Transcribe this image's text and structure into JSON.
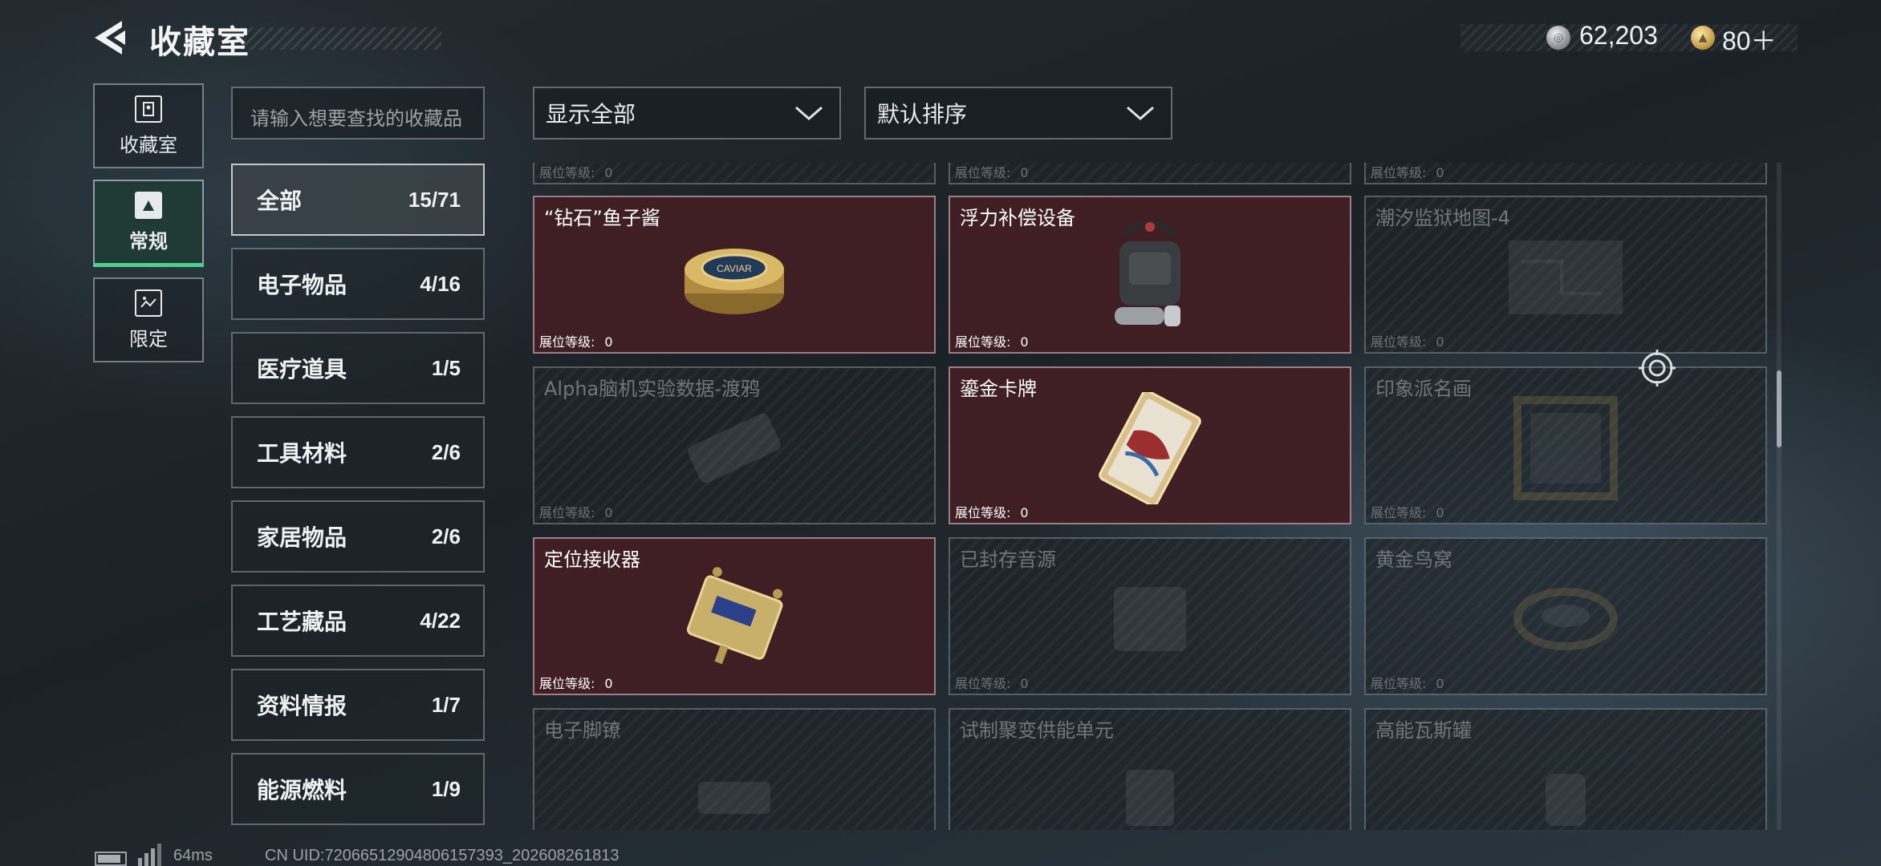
{
  "header": {
    "title": "收藏室",
    "currency_silver": "62,203",
    "currency_gold": "80＋"
  },
  "nav": {
    "tabs": [
      {
        "label": "收藏室",
        "icon": "collection-room-icon"
      },
      {
        "label": "常规",
        "icon": "regular-collection-icon",
        "active": true
      },
      {
        "label": "限定",
        "icon": "limited-collection-icon"
      }
    ]
  },
  "search": {
    "placeholder": "请输入想要查找的收藏品"
  },
  "categories": [
    {
      "label": "全部",
      "count": "15/71",
      "active": true
    },
    {
      "label": "电子物品",
      "count": "4/16"
    },
    {
      "label": "医疗道具",
      "count": "1/5"
    },
    {
      "label": "工具材料",
      "count": "2/6"
    },
    {
      "label": "家居物品",
      "count": "2/6"
    },
    {
      "label": "工艺藏品",
      "count": "4/22"
    },
    {
      "label": "资料情报",
      "count": "1/7"
    },
    {
      "label": "能源燃料",
      "count": "1/9"
    }
  ],
  "filters": {
    "display": "显示全部",
    "sort": "默认排序"
  },
  "level_label": "展位等级:",
  "items": [
    {
      "name": "",
      "level": "0",
      "owned": false
    },
    {
      "name": "",
      "level": "0",
      "owned": false
    },
    {
      "name": "",
      "level": "0",
      "owned": false
    },
    {
      "name": "“钻石”鱼子酱",
      "level": "0",
      "owned": true,
      "icon": "caviar-tin-icon"
    },
    {
      "name": "浮力补偿设备",
      "level": "0",
      "owned": true,
      "icon": "buoyancy-device-icon"
    },
    {
      "name": "潮汐监狱地图-4",
      "level": "0",
      "owned": false,
      "icon": "map-icon"
    },
    {
      "name": "Alpha脑机实验数据-渡鸦",
      "level": "0",
      "owned": false,
      "icon": "data-module-icon"
    },
    {
      "name": "鎏金卡牌",
      "level": "0",
      "owned": true,
      "icon": "gilded-card-icon"
    },
    {
      "name": "印象派名画",
      "level": "0",
      "owned": false,
      "icon": "painting-icon"
    },
    {
      "name": "定位接收器",
      "level": "0",
      "owned": true,
      "icon": "locator-receiver-icon"
    },
    {
      "name": "已封存音源",
      "level": "0",
      "owned": false,
      "icon": "sealed-audio-icon"
    },
    {
      "name": "黄金鸟窝",
      "level": "0",
      "owned": false,
      "icon": "golden-nest-icon"
    },
    {
      "name": "电子脚镣",
      "level": "",
      "owned": false,
      "icon": "ankle-monitor-icon"
    },
    {
      "name": "试制聚变供能单元",
      "level": "",
      "owned": false,
      "icon": "fusion-unit-icon"
    },
    {
      "name": "高能瓦斯罐",
      "level": "",
      "owned": false,
      "icon": "gas-canister-icon"
    }
  ],
  "footer": {
    "ping": "64ms",
    "uid": "CN UID:720665129048061​57393_202608261813"
  },
  "colors": {
    "owned_card": "#3f1e24",
    "active_tab_accent": "#4cd08f"
  }
}
